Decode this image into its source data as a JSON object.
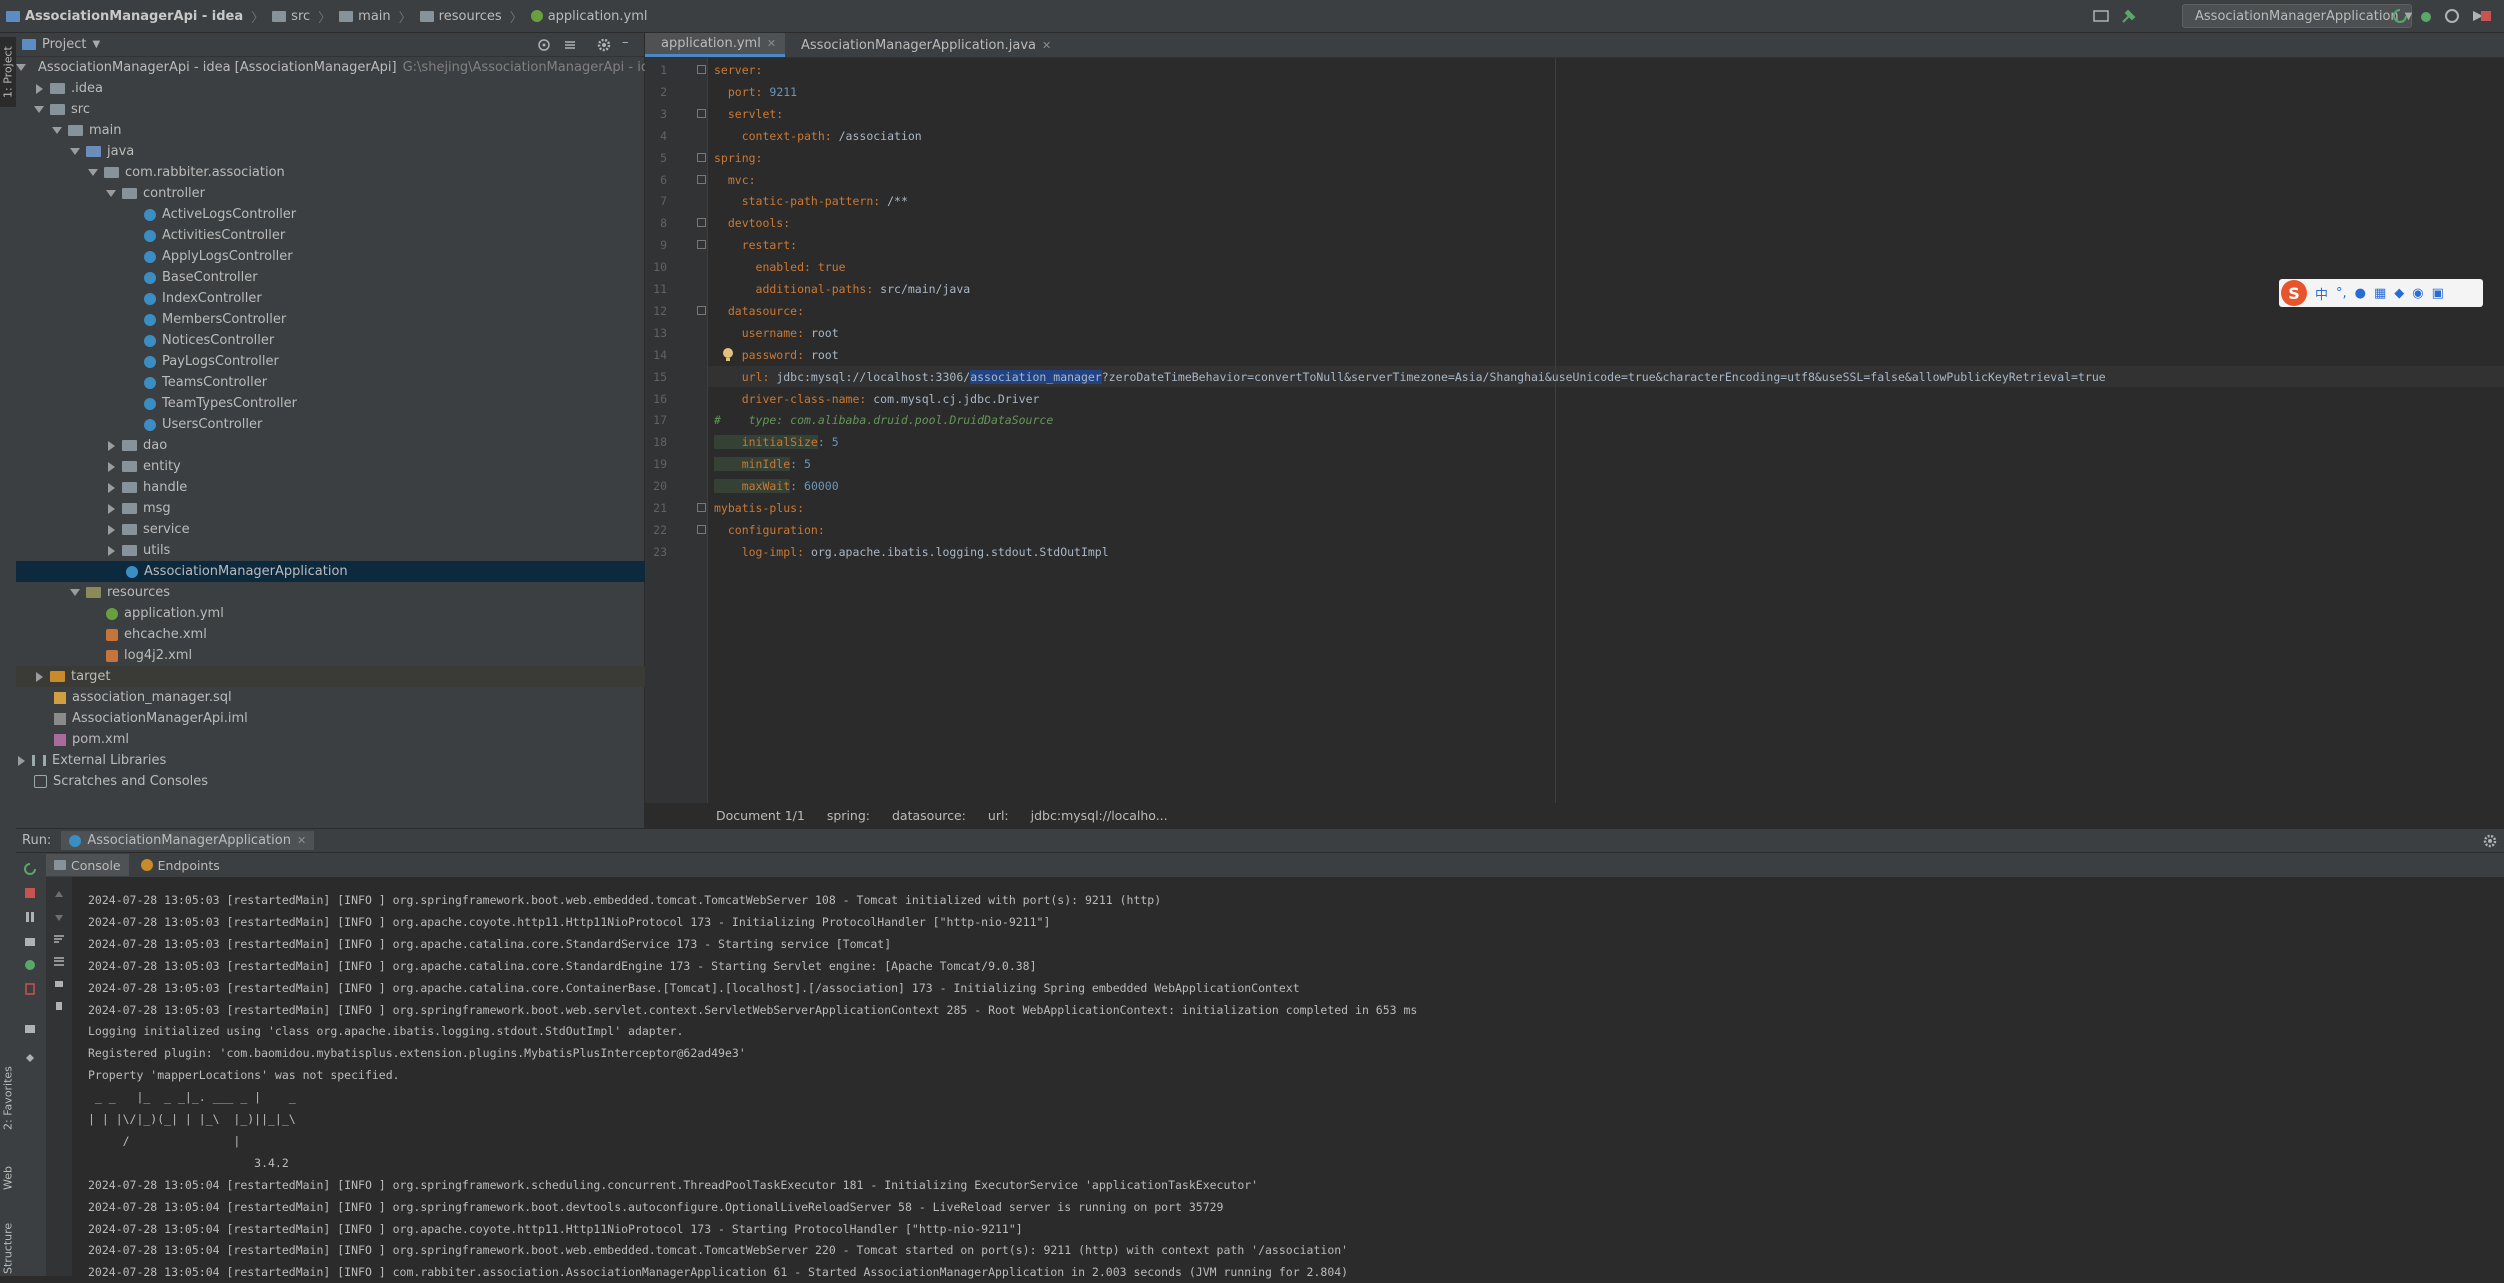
{
  "breadcrumb": {
    "project": "AssociationManagerApi - idea",
    "items": [
      "src",
      "main",
      "resources",
      "application.yml"
    ]
  },
  "run_config": {
    "label": "AssociationManagerApplication"
  },
  "left_strip": {
    "project_tab": "1: Project",
    "favorites_tab": "2: Favorites",
    "web_tab": "Web",
    "structure_tab": "Structure"
  },
  "project_panel": {
    "title": "Project",
    "tree": [
      {
        "label": "AssociationManagerApi - idea [AssociationManagerApi]",
        "extra": "G:\\shejing\\AssociationManagerApi - idea"
      },
      {
        "label": ".idea"
      },
      {
        "label": "src"
      },
      {
        "label": "main"
      },
      {
        "label": "java"
      },
      {
        "label": "com.rabbiter.association"
      },
      {
        "label": "controller"
      },
      {
        "label": "ActiveLogsController"
      },
      {
        "label": "ActivitiesController"
      },
      {
        "label": "ApplyLogsController"
      },
      {
        "label": "BaseController"
      },
      {
        "label": "IndexController"
      },
      {
        "label": "MembersController"
      },
      {
        "label": "NoticesController"
      },
      {
        "label": "PayLogsController"
      },
      {
        "label": "TeamsController"
      },
      {
        "label": "TeamTypesController"
      },
      {
        "label": "UsersController"
      },
      {
        "label": "dao"
      },
      {
        "label": "entity"
      },
      {
        "label": "handle"
      },
      {
        "label": "msg"
      },
      {
        "label": "service"
      },
      {
        "label": "utils"
      },
      {
        "label": "AssociationManagerApplication"
      },
      {
        "label": "resources"
      },
      {
        "label": "application.yml"
      },
      {
        "label": "ehcache.xml"
      },
      {
        "label": "log4j2.xml"
      },
      {
        "label": "target"
      },
      {
        "label": "association_manager.sql"
      },
      {
        "label": "AssociationManagerApi.iml"
      },
      {
        "label": "pom.xml"
      },
      {
        "label": "External Libraries"
      },
      {
        "label": "Scratches and Consoles"
      }
    ]
  },
  "editor": {
    "tabs": [
      {
        "label": "application.yml"
      },
      {
        "label": "AssociationManagerApplication.java"
      }
    ],
    "line_numbers": [
      "1",
      "2",
      "3",
      "4",
      "5",
      "6",
      "7",
      "8",
      "9",
      "10",
      "11",
      "12",
      "13",
      "14",
      "15",
      "16",
      "17",
      "18",
      "19",
      "20",
      "21",
      "22",
      "23"
    ],
    "lines": [
      {
        "key": "server:",
        "val": ""
      },
      {
        "key": "  port:",
        "val": " 9211"
      },
      {
        "key": "  servlet:",
        "val": ""
      },
      {
        "key": "    context-path:",
        "val": " /association"
      },
      {
        "key": "spring:",
        "val": ""
      },
      {
        "key": "  mvc:",
        "val": ""
      },
      {
        "key": "    static-path-pattern:",
        "val": " /**"
      },
      {
        "key": "  devtools:",
        "val": ""
      },
      {
        "key": "    restart:",
        "val": ""
      },
      {
        "key": "      enabled:",
        "val": " true"
      },
      {
        "key": "      additional-paths:",
        "val": " src/main/java"
      },
      {
        "key": "  datasource:",
        "val": ""
      },
      {
        "key": "    username:",
        "val": " root"
      },
      {
        "key": "    password:",
        "val": " root"
      },
      {
        "key": "    url:",
        "val_a": " jdbc:mysql://localhost:3306/",
        "val_hl": "association_manager",
        "val_b": "?zeroDateTimeBehavior=convertToNull&serverTimezone=Asia/Shanghai&useUnicode=true&characterEncoding=utf8&useSSL=false&allowPublicKeyRetrieval=true"
      },
      {
        "key": "    driver-class-name:",
        "val": " com.mysql.cj.jdbc.Driver"
      },
      {
        "comment": "#    type: com.alibaba.druid.pool.DruidDataSource"
      },
      {
        "key": "    initialSize",
        "val": ": 5"
      },
      {
        "key": "    minIdle",
        "val": ": 5"
      },
      {
        "key": "    maxWait",
        "val": ": 60000"
      },
      {
        "key": "mybatis-plus:",
        "val": ""
      },
      {
        "key": "  configuration:",
        "val": ""
      },
      {
        "key": "    log-impl:",
        "val": " org.apache.ibatis.logging.stdout.StdOutImpl"
      }
    ],
    "breadcrumbs": [
      "Document 1/1",
      "spring:",
      "datasource:",
      "url:",
      "jdbc:mysql://localho..."
    ]
  },
  "run_panel": {
    "label": "Run:",
    "config_tab": "AssociationManagerApplication",
    "tabs": [
      "Console",
      "Endpoints"
    ],
    "console_lines": [
      "2024-07-28 13:05:03 [restartedMain] [INFO ] org.springframework.boot.web.embedded.tomcat.TomcatWebServer 108 - Tomcat initialized with port(s): 9211 (http)",
      "2024-07-28 13:05:03 [restartedMain] [INFO ] org.apache.coyote.http11.Http11NioProtocol 173 - Initializing ProtocolHandler [\"http-nio-9211\"]",
      "2024-07-28 13:05:03 [restartedMain] [INFO ] org.apache.catalina.core.StandardService 173 - Starting service [Tomcat]",
      "2024-07-28 13:05:03 [restartedMain] [INFO ] org.apache.catalina.core.StandardEngine 173 - Starting Servlet engine: [Apache Tomcat/9.0.38]",
      "2024-07-28 13:05:03 [restartedMain] [INFO ] org.apache.catalina.core.ContainerBase.[Tomcat].[localhost].[/association] 173 - Initializing Spring embedded WebApplicationContext",
      "2024-07-28 13:05:03 [restartedMain] [INFO ] org.springframework.boot.web.servlet.context.ServletWebServerApplicationContext 285 - Root WebApplicationContext: initialization completed in 653 ms",
      "Logging initialized using 'class org.apache.ibatis.logging.stdout.StdOutImpl' adapter.",
      "Registered plugin: 'com.baomidou.mybatisplus.extension.plugins.MybatisPlusInterceptor@62ad49e3'",
      "Property 'mapperLocations' was not specified.",
      " _ _   |_  _ _|_. ___ _ |    _",
      "| | |\\/|_)(_| | |_\\  |_)||_|_\\",
      "     /               |",
      "                        3.4.2",
      "2024-07-28 13:05:04 [restartedMain] [INFO ] org.springframework.scheduling.concurrent.ThreadPoolTaskExecutor 181 - Initializing ExecutorService 'applicationTaskExecutor'",
      "2024-07-28 13:05:04 [restartedMain] [INFO ] org.springframework.boot.devtools.autoconfigure.OptionalLiveReloadServer 58 - LiveReload server is running on port 35729",
      "2024-07-28 13:05:04 [restartedMain] [INFO ] org.apache.coyote.http11.Http11NioProtocol 173 - Starting ProtocolHandler [\"http-nio-9211\"]",
      "2024-07-28 13:05:04 [restartedMain] [INFO ] org.springframework.boot.web.embedded.tomcat.TomcatWebServer 220 - Tomcat started on port(s): 9211 (http) with context path '/association'",
      "2024-07-28 13:05:04 [restartedMain] [INFO ] com.rabbiter.association.AssociationManagerApplication 61 - Started AssociationManagerApplication in 2.003 seconds (JVM running for 2.804)"
    ]
  },
  "ime_toolbar": {
    "logo": "S",
    "lang": "中"
  },
  "colors": {
    "accent": "#4a88c7",
    "selection": "#0d293e",
    "keyword": "#cc7832",
    "number": "#6897bb",
    "string": "#6a8759"
  }
}
